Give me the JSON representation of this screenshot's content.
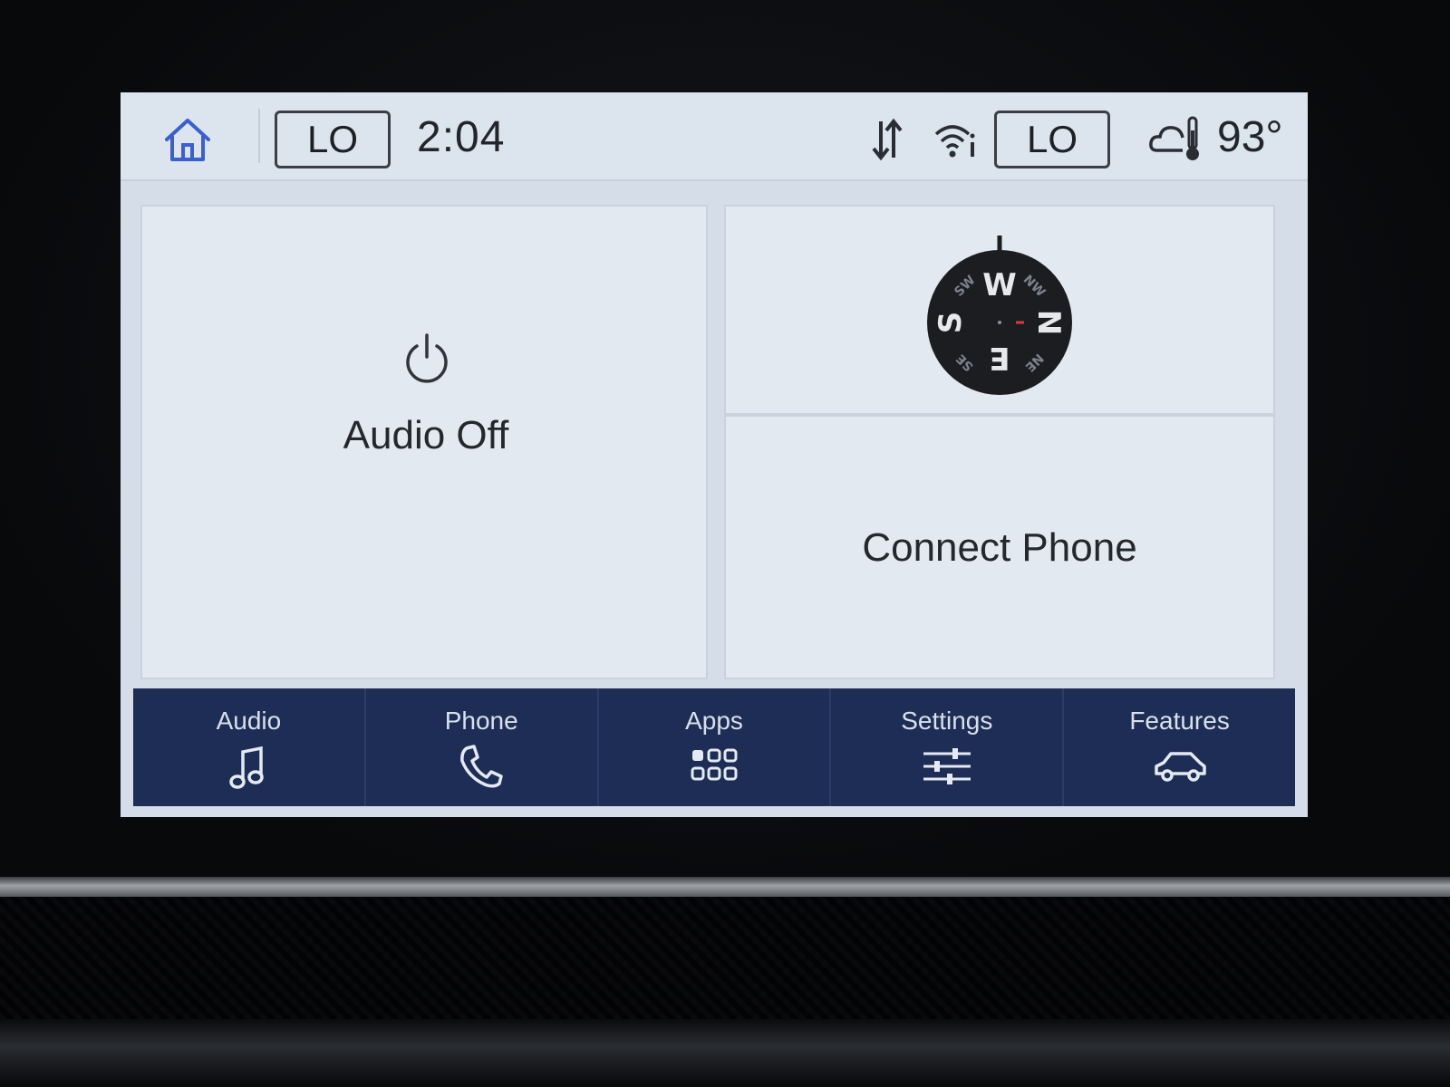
{
  "status_bar": {
    "left_climate": "LO",
    "time": "2:04",
    "right_climate": "LO",
    "temperature": "93°",
    "icons": [
      "home-icon",
      "sync-icon",
      "wifi-icon",
      "weather-icon"
    ]
  },
  "tiles": {
    "audio": {
      "label": "Audio Off",
      "icon": "power-icon"
    },
    "compass": {
      "icon": "compass-icon",
      "directions": {
        "north": "N",
        "south": "S",
        "east": "E",
        "west": "W",
        "nw": "NW",
        "ne": "NE",
        "sw": "SW",
        "se": "SE"
      }
    },
    "phone": {
      "label": "Connect Phone"
    }
  },
  "nav": [
    {
      "label": "Audio",
      "icon": "music-note-icon"
    },
    {
      "label": "Phone",
      "icon": "phone-icon"
    },
    {
      "label": "Apps",
      "icon": "apps-grid-icon"
    },
    {
      "label": "Settings",
      "icon": "sliders-icon"
    },
    {
      "label": "Features",
      "icon": "car-icon"
    }
  ],
  "colors": {
    "screen_bg": "#d4dde8",
    "tile_bg": "#e3e9f1",
    "navbar_bg": "#1e2d55",
    "home_icon": "#3a5fd0",
    "text": "#24282e"
  }
}
